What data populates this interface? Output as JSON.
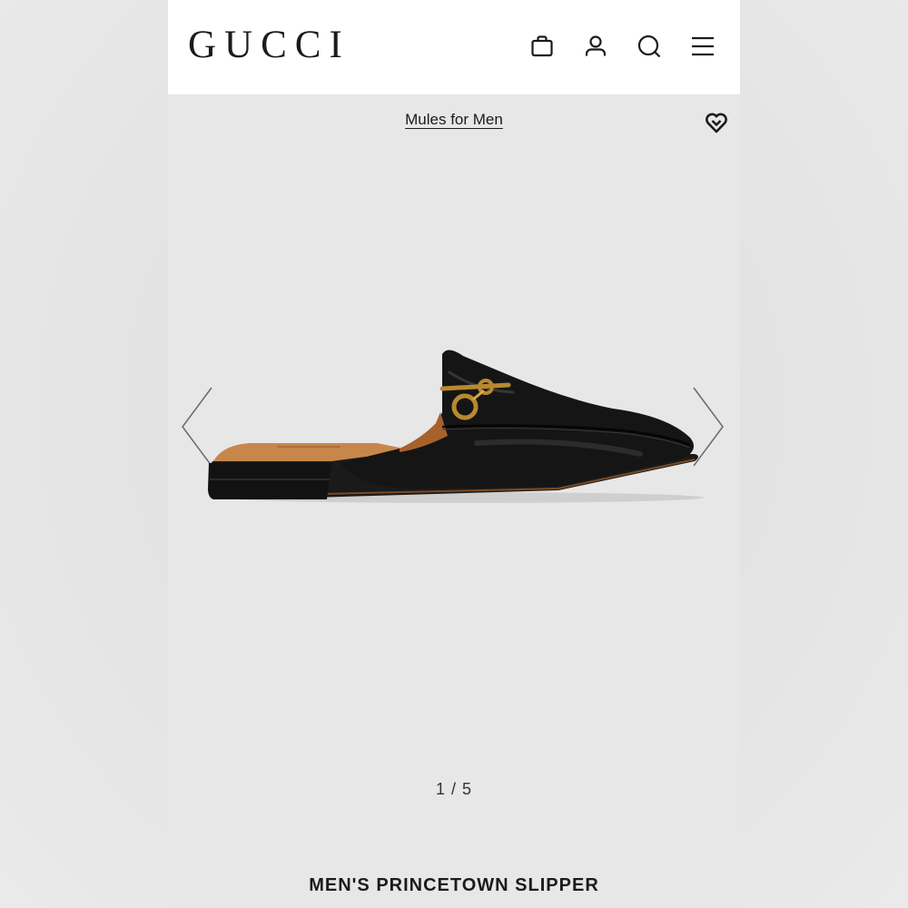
{
  "header": {
    "logo": "GUCCI",
    "icons": [
      "shopping-bag-icon",
      "account-icon",
      "search-icon",
      "menu-icon"
    ]
  },
  "breadcrumb": {
    "label": "Mules for Men"
  },
  "wishlist": {
    "icon": "heart-icon"
  },
  "gallery": {
    "current": 1,
    "total": 5,
    "pager_text": "1 / 5",
    "image_icon": "loafer-mule-image"
  },
  "product": {
    "name": "MEN'S PRINCETOWN SLIPPER"
  },
  "colors": {
    "page_background": "#e7e7e7",
    "header_background": "#ffffff",
    "text": "#1b1b1b",
    "shoe_leather": "#141414",
    "hardware_gold": "#b8892f",
    "lining_tan": "#c8874a"
  }
}
